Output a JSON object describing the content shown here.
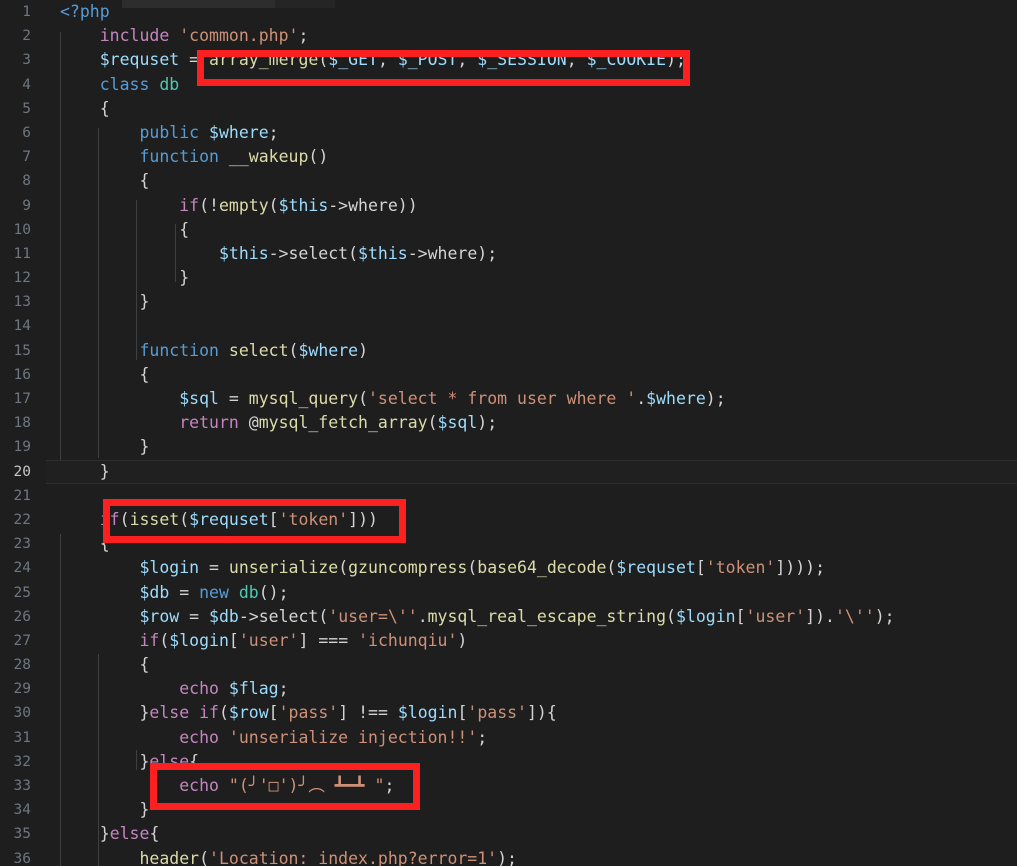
{
  "editor": {
    "language": "php",
    "active_line": 20,
    "background": "#1e1e1e",
    "line_number_color": "#6e7681",
    "annotation_color": "#fc2020"
  },
  "lines": [
    {
      "n": "1",
      "indent": 0,
      "text": "<?php"
    },
    {
      "n": "2",
      "indent": 1,
      "text": "include 'common.php';"
    },
    {
      "n": "3",
      "indent": 1,
      "text": "$requset = array_merge($_GET, $_POST, $_SESSION, $_COOKIE);"
    },
    {
      "n": "4",
      "indent": 1,
      "text": "class db"
    },
    {
      "n": "5",
      "indent": 1,
      "text": "{"
    },
    {
      "n": "6",
      "indent": 2,
      "text": "public $where;"
    },
    {
      "n": "7",
      "indent": 2,
      "text": "function __wakeup()"
    },
    {
      "n": "8",
      "indent": 2,
      "text": "{"
    },
    {
      "n": "9",
      "indent": 3,
      "text": "if(!empty($this->where))"
    },
    {
      "n": "10",
      "indent": 3,
      "text": "{"
    },
    {
      "n": "11",
      "indent": 4,
      "text": "$this->select($this->where);"
    },
    {
      "n": "12",
      "indent": 3,
      "text": "}"
    },
    {
      "n": "13",
      "indent": 2,
      "text": "}"
    },
    {
      "n": "14",
      "indent": 0,
      "text": ""
    },
    {
      "n": "15",
      "indent": 2,
      "text": "function select($where)"
    },
    {
      "n": "16",
      "indent": 2,
      "text": "{"
    },
    {
      "n": "17",
      "indent": 3,
      "text": "$sql = mysql_query('select * from user where '.$where);"
    },
    {
      "n": "18",
      "indent": 3,
      "text": "return @mysql_fetch_array($sql);"
    },
    {
      "n": "19",
      "indent": 2,
      "text": "}"
    },
    {
      "n": "20",
      "indent": 1,
      "text": "}"
    },
    {
      "n": "21",
      "indent": 0,
      "text": ""
    },
    {
      "n": "22",
      "indent": 1,
      "text": "if(isset($requset['token']))"
    },
    {
      "n": "23",
      "indent": 1,
      "text": "{"
    },
    {
      "n": "24",
      "indent": 2,
      "text": "$login = unserialize(gzuncompress(base64_decode($requset['token'])));"
    },
    {
      "n": "25",
      "indent": 2,
      "text": "$db = new db();"
    },
    {
      "n": "26",
      "indent": 2,
      "text": "$row = $db->select('user=\\''.mysql_real_escape_string($login['user']).'\\'');"
    },
    {
      "n": "27",
      "indent": 2,
      "text": "if($login['user'] === 'ichunqiu')"
    },
    {
      "n": "28",
      "indent": 2,
      "text": "{"
    },
    {
      "n": "29",
      "indent": 3,
      "text": "echo $flag;"
    },
    {
      "n": "30",
      "indent": 2,
      "text": "}else if($row['pass'] !== $login['pass']){"
    },
    {
      "n": "31",
      "indent": 3,
      "text": "echo 'unserialize injection!!';"
    },
    {
      "n": "32",
      "indent": 2,
      "text": "}else{"
    },
    {
      "n": "33",
      "indent": 3,
      "text": "echo \"(╯'□')╯︵ ┻━┻ \";"
    },
    {
      "n": "34",
      "indent": 2,
      "text": "}"
    },
    {
      "n": "35",
      "indent": 1,
      "text": "}else{"
    },
    {
      "n": "36",
      "indent": 2,
      "text": "header('Location: index.php?error=1');"
    }
  ],
  "annotations": [
    {
      "label": "array-merge-call-highlight",
      "target_line": "3",
      "text": "array_merge($_GET, $_POST, $_SESSION, $_COOKIE);"
    },
    {
      "label": "isset-token-check-highlight",
      "target_line": "22",
      "text": "if(isset($requset['token']))"
    },
    {
      "label": "table-flip-echo-highlight",
      "target_line": "33",
      "text": "echo \"(╯'□')╯︵ ┻━┻ \";"
    }
  ]
}
